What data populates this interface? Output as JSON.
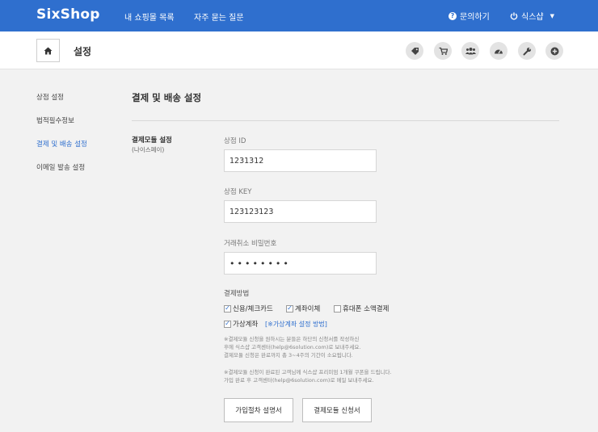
{
  "header": {
    "logo": "SixShop",
    "nav": [
      "내 쇼핑몰 목록",
      "자주 묻는 질문"
    ],
    "help_label": "문의하기",
    "user_label": "식스샵",
    "color": "#2f6fce"
  },
  "subheader": {
    "title": "설정",
    "icons": [
      "tag-icon",
      "cart-icon",
      "users-icon",
      "dashboard-icon",
      "wrench-icon",
      "plus-circle-icon"
    ]
  },
  "sidebar": {
    "items": [
      {
        "label": "상점 설정",
        "active": false
      },
      {
        "label": "법적필수정보",
        "active": false
      },
      {
        "label": "결제 및 배송 설정",
        "active": true
      },
      {
        "label": "이메일 발송 설정",
        "active": false
      }
    ]
  },
  "main": {
    "title": "결제 및 배송 설정",
    "group_title": "결제모듈 설정",
    "group_sub": "(나이스페이)",
    "fields": [
      {
        "label": "상점 ID",
        "value": "1231312"
      },
      {
        "label": "상점 KEY",
        "value": "123123123"
      },
      {
        "label": "거래취소 비밀번호",
        "value": "••••••••"
      }
    ],
    "payment_label": "결제방법",
    "payment_methods": [
      {
        "label": "신용/체크카드",
        "checked": true
      },
      {
        "label": "계좌이체",
        "checked": true
      },
      {
        "label": "휴대폰 소액결제",
        "checked": false
      },
      {
        "label": "가상계좌",
        "checked": true
      }
    ],
    "virtual_link": "[※가상계좌 설정 방법]",
    "notes": [
      "※결제모듈 신청을 원하시는 분들은 하단의 신청서를 작성하신",
      "후에 식스샵 고객센터(help@6solution.com)로 보내주세요.",
      "결제모듈 신청은 완료까지 총 3~4주의 기간이 소요됩니다.",
      "※결제모듈 신청이 완료된 고객님께 식스샵 프리미엄 1개월 쿠폰을 드립니다.",
      "가입 완료 후 고객센터(help@6solution.com)로 메일 보내주세요."
    ],
    "buttons": [
      "가입절차 설명서",
      "결제모듈 신청서"
    ]
  }
}
